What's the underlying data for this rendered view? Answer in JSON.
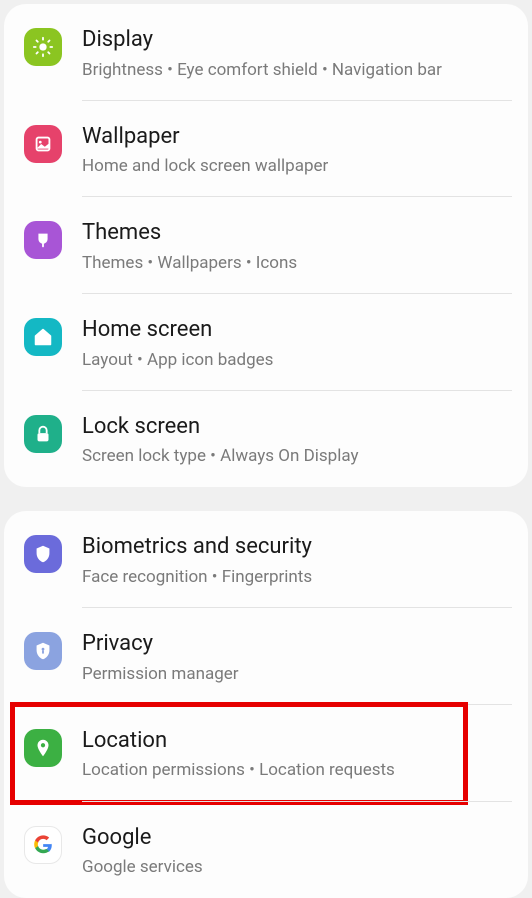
{
  "group1": {
    "display": {
      "title": "Display",
      "subtitle": "Brightness  •  Eye comfort shield  •  Navigation bar",
      "icon_bg": "#8bc521"
    },
    "wallpaper": {
      "title": "Wallpaper",
      "subtitle": "Home and lock screen wallpaper",
      "icon_bg": "#e6426b"
    },
    "themes": {
      "title": "Themes",
      "subtitle": "Themes  •  Wallpapers  •  Icons",
      "icon_bg": "#a855d6"
    },
    "homescreen": {
      "title": "Home screen",
      "subtitle": "Layout  •  App icon badges",
      "icon_bg": "#14b8c4"
    },
    "lockscreen": {
      "title": "Lock screen",
      "subtitle": "Screen lock type  •  Always On Display",
      "icon_bg": "#1fb08a"
    }
  },
  "group2": {
    "biometrics": {
      "title": "Biometrics and security",
      "subtitle": "Face recognition  •  Fingerprints",
      "icon_bg": "#6b6bdb"
    },
    "privacy": {
      "title": "Privacy",
      "subtitle": "Permission manager",
      "icon_bg": "#8ba3e0"
    },
    "location": {
      "title": "Location",
      "subtitle": "Location permissions  •  Location requests",
      "icon_bg": "#3cb043"
    },
    "google": {
      "title": "Google",
      "subtitle": "Google services",
      "icon_bg": "#ffffff"
    }
  }
}
